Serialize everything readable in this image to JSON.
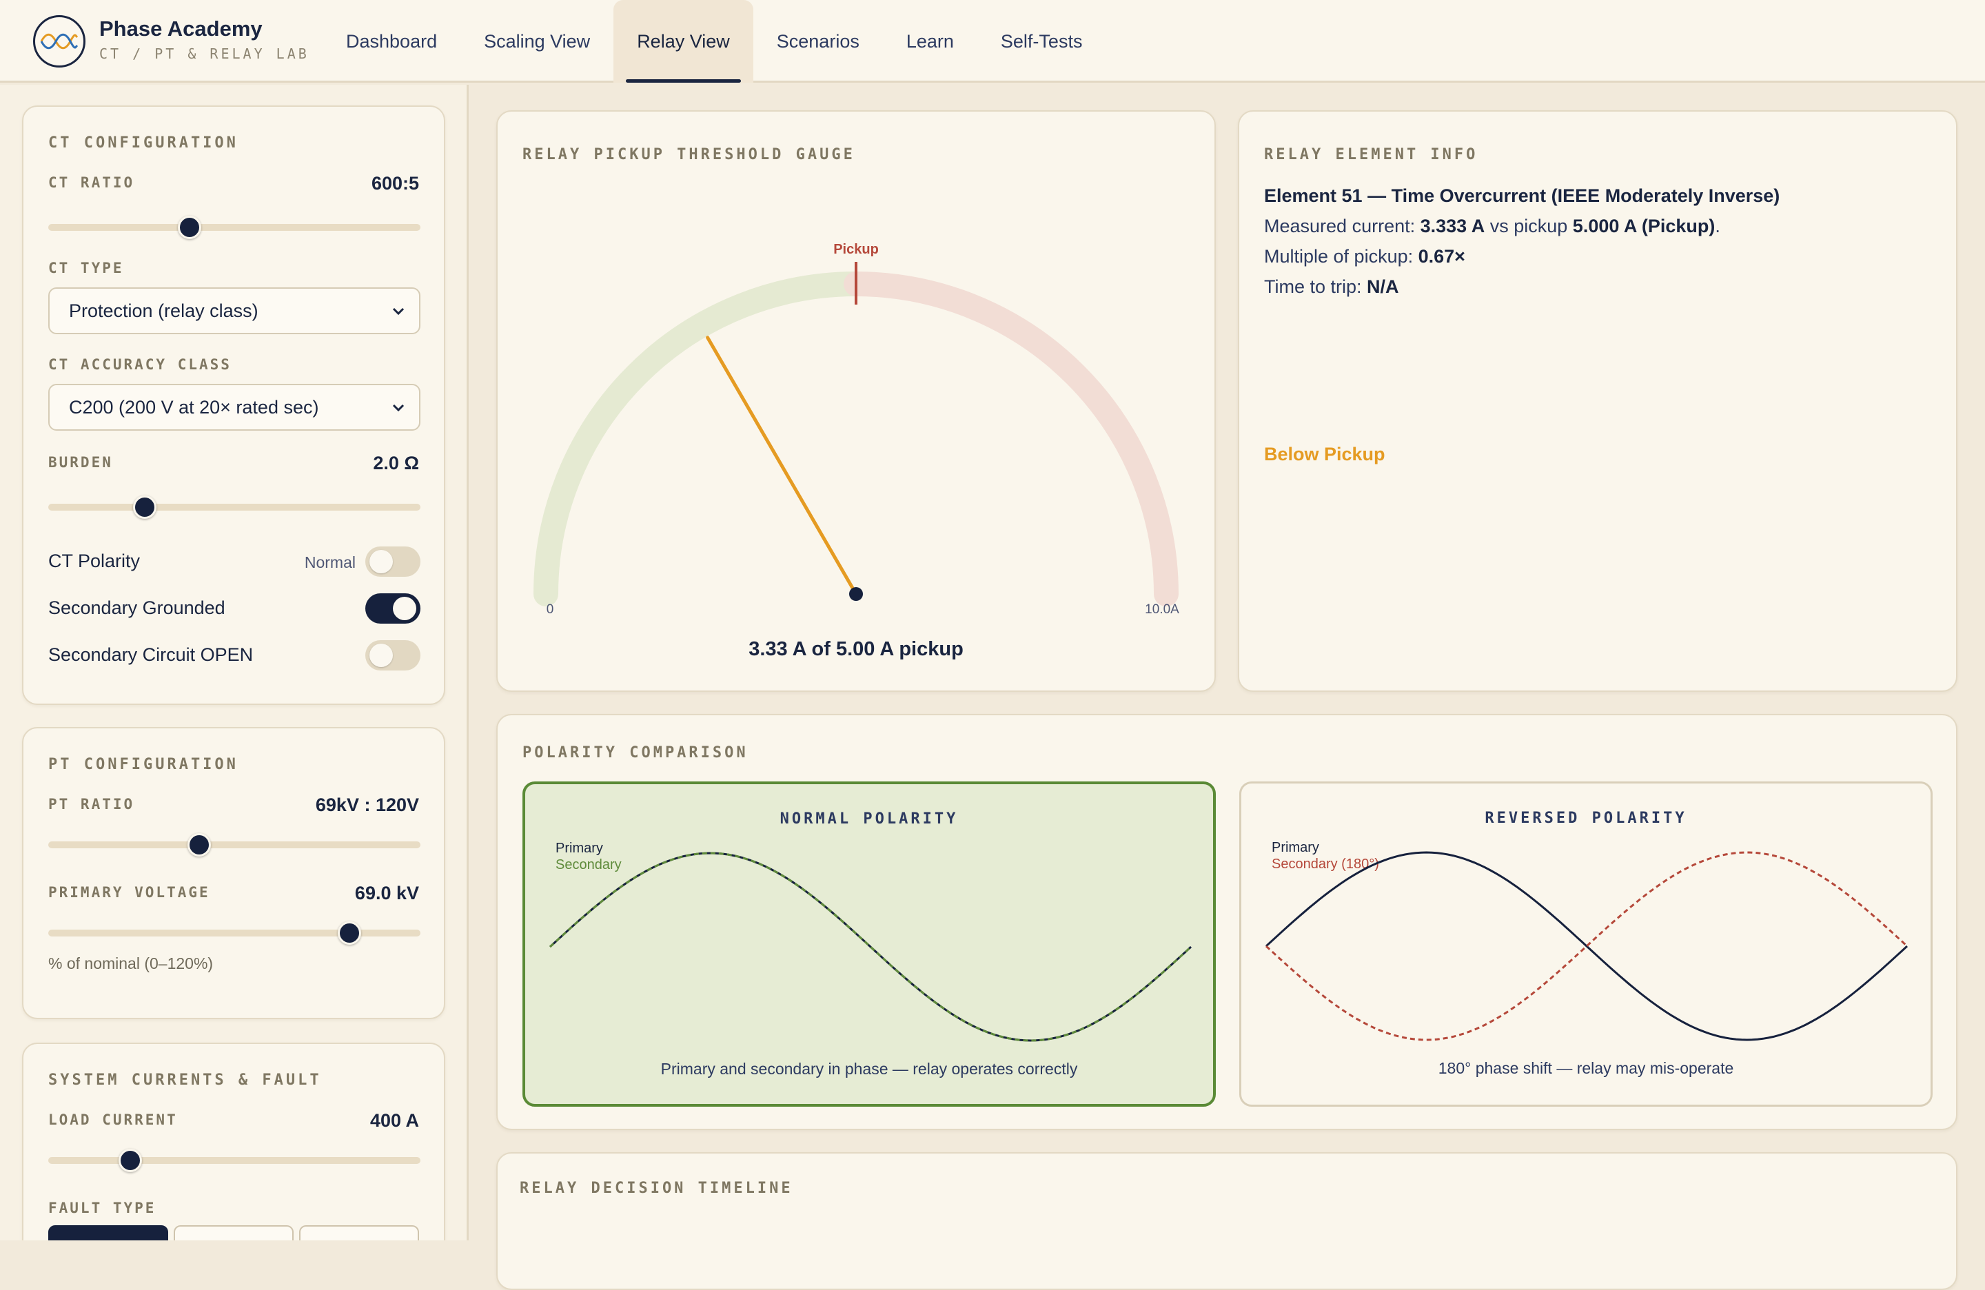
{
  "app": {
    "title": "Phase Academy",
    "subtitle": "CT / PT & RELAY LAB",
    "logo_icon": "sine-waves-icon"
  },
  "nav": {
    "items": [
      {
        "label": "Dashboard"
      },
      {
        "label": "Scaling View"
      },
      {
        "label": "Relay View",
        "active": true
      },
      {
        "label": "Scenarios"
      },
      {
        "label": "Learn"
      },
      {
        "label": "Self-Tests"
      }
    ]
  },
  "ct_config": {
    "title": "CT CONFIGURATION",
    "ratio_label": "CT RATIO",
    "ratio_value": "600:5",
    "ratio_slider_fraction": 0.38,
    "type_label": "CT TYPE",
    "type_value": "Protection (relay class)",
    "accuracy_label": "CT ACCURACY CLASS",
    "accuracy_value": "C200 (200 V at 20× rated sec)",
    "burden_label": "BURDEN",
    "burden_value": "2.0 Ω",
    "burden_slider_fraction": 0.26,
    "polarity_label": "CT Polarity",
    "polarity_state": "Normal",
    "polarity_on": false,
    "grounded_label": "Secondary Grounded",
    "grounded_on": true,
    "open_label": "Secondary Circuit OPEN",
    "open_on": false
  },
  "pt_config": {
    "title": "PT CONFIGURATION",
    "ratio_label": "PT RATIO",
    "ratio_value": "69kV : 120V",
    "ratio_slider_fraction": 0.405,
    "voltage_label": "PRIMARY VOLTAGE",
    "voltage_value": "69.0 kV",
    "voltage_slider_fraction": 0.81,
    "voltage_hint": "% of nominal (0–120%)"
  },
  "system": {
    "title": "SYSTEM CURRENTS & FAULT",
    "load_label": "LOAD CURRENT",
    "load_value": "400 A",
    "load_slider_fraction": 0.22,
    "fault_label": "FAULT TYPE"
  },
  "gauge": {
    "title": "RELAY PICKUP THRESHOLD GAUGE",
    "pickup_label": "Pickup",
    "min_label": "0",
    "max_label": "10.0A",
    "value": 3.33,
    "pickup": 5.0,
    "max": 10.0,
    "caption": "3.33 A of 5.00 A pickup",
    "colors": {
      "below": "#e5ead2",
      "above": "#f2ddd5",
      "needle": "#e59b22",
      "pickup": "#b5483a"
    }
  },
  "relay_info": {
    "title": "RELAY ELEMENT INFO",
    "element": "Element 51 — Time Overcurrent (IEEE Moderately Inverse)",
    "measured_prefix": "Measured current:",
    "measured_value": "3.333 A",
    "vs_pickup_text": "vs pickup",
    "pickup_value": "5.000 A (Pickup)",
    "multiple_prefix": "Multiple of pickup:",
    "multiple_value": "0.67×",
    "time_prefix": "Time to trip:",
    "time_value": "N/A",
    "status": "Below Pickup"
  },
  "polarity": {
    "title": "POLARITY COMPARISON",
    "normal": {
      "title": "NORMAL POLARITY",
      "primary_label": "Primary",
      "secondary_label": "Secondary",
      "caption": "Primary and secondary in phase — relay operates correctly"
    },
    "reversed": {
      "title": "REVERSED POLARITY",
      "primary_label": "Primary",
      "secondary_label": "Secondary (180°)",
      "caption": "180° phase shift — relay may mis-operate"
    }
  },
  "timeline": {
    "title": "RELAY DECISION TIMELINE"
  }
}
